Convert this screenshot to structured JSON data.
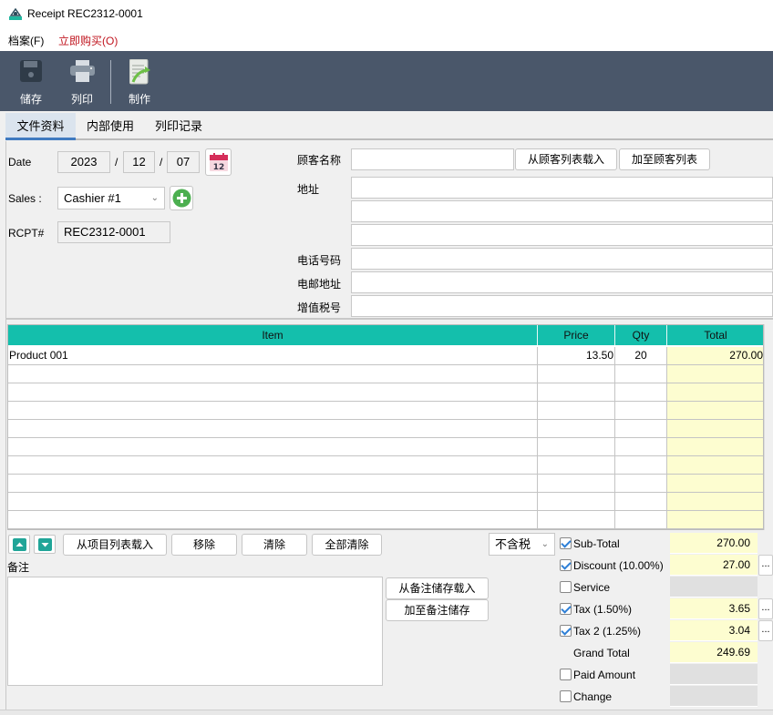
{
  "window": {
    "title": "Receipt REC2312-0001",
    "app_icon": "receipt-app-icon"
  },
  "menu": {
    "file": "档案(F)",
    "buy_now": "立即购买(O)"
  },
  "toolbar": {
    "save": {
      "label": "储存",
      "icon": "floppy-disk-icon"
    },
    "print": {
      "label": "列印",
      "icon": "printer-icon"
    },
    "make": {
      "label": "制作",
      "icon": "document-arrow-icon"
    }
  },
  "tabs": [
    {
      "label": "文件资料",
      "active": true
    },
    {
      "label": "内部使用",
      "active": false
    },
    {
      "label": "列印记录",
      "active": false
    }
  ],
  "form": {
    "date_label": "Date",
    "date_year": "2023",
    "date_sep": "/",
    "date_month": "12",
    "date_day": "07",
    "calendar_icon_text": "12",
    "sales_label": "Sales :",
    "sales_value": "Cashier #1",
    "rcpt_label": "RCPT#",
    "rcpt_value": "REC2312-0001"
  },
  "customer": {
    "name_label": "顾客名称",
    "name_value": "",
    "load_btn": "从顾客列表载入",
    "add_btn": "加至顾客列表",
    "address_label": "地址",
    "address_lines": [
      "",
      "",
      ""
    ],
    "phone_label": "电话号码",
    "phone_value": "",
    "email_label": "电邮地址",
    "email_value": "",
    "vat_label": "增值税号",
    "vat_value": ""
  },
  "grid": {
    "columns": [
      "Item",
      "Price",
      "Qty",
      "Total"
    ],
    "rows": [
      {
        "item": "Product 001",
        "price": "13.50",
        "qty": "20",
        "total": "270.00"
      },
      {
        "item": "",
        "price": "",
        "qty": "",
        "total": ""
      },
      {
        "item": "",
        "price": "",
        "qty": "",
        "total": ""
      },
      {
        "item": "",
        "price": "",
        "qty": "",
        "total": ""
      },
      {
        "item": "",
        "price": "",
        "qty": "",
        "total": ""
      },
      {
        "item": "",
        "price": "",
        "qty": "",
        "total": ""
      },
      {
        "item": "",
        "price": "",
        "qty": "",
        "total": ""
      },
      {
        "item": "",
        "price": "",
        "qty": "",
        "total": ""
      },
      {
        "item": "",
        "price": "",
        "qty": "",
        "total": ""
      },
      {
        "item": "",
        "price": "",
        "qty": "",
        "total": ""
      }
    ]
  },
  "grid_actions": {
    "load_items": "从项目列表载入",
    "remove": "移除",
    "clear": "清除",
    "clear_all": "全部清除",
    "tax_mode": "不含税"
  },
  "notes": {
    "label": "备注",
    "value": "",
    "load_btn": "从备注储存载入",
    "save_btn": "加至备注储存"
  },
  "totals": [
    {
      "key": "subtotal",
      "label": "Sub-Total",
      "checkbox": true,
      "checked": true,
      "value": "270.00",
      "style": "yellow",
      "more": false
    },
    {
      "key": "discount",
      "label": "Discount (10.00%)",
      "checkbox": true,
      "checked": true,
      "value": "27.00",
      "style": "yellow",
      "more": true
    },
    {
      "key": "service",
      "label": "Service",
      "checkbox": true,
      "checked": false,
      "value": "",
      "style": "grey",
      "more": false
    },
    {
      "key": "tax",
      "label": "Tax (1.50%)",
      "checkbox": true,
      "checked": true,
      "value": "3.65",
      "style": "yellow",
      "more": true
    },
    {
      "key": "tax2",
      "label": "Tax 2 (1.25%)",
      "checkbox": true,
      "checked": true,
      "value": "3.04",
      "style": "yellow",
      "more": true
    },
    {
      "key": "grand_total",
      "label": "Grand Total",
      "checkbox": false,
      "checked": false,
      "value": "249.69",
      "style": "yellow",
      "more": false
    },
    {
      "key": "paid",
      "label": "Paid Amount",
      "checkbox": true,
      "checked": false,
      "value": "",
      "style": "grey",
      "more": false
    },
    {
      "key": "change",
      "label": "Change",
      "checkbox": true,
      "checked": false,
      "value": "",
      "style": "grey",
      "more": false
    }
  ],
  "more_button_label": "...",
  "colors": {
    "toolbar_bg": "#4a576a",
    "grid_header": "#14bfac",
    "total_cell": "#fdfdd0",
    "accent": "#3f7ac0",
    "menu_buy_now": "#c0141e"
  }
}
